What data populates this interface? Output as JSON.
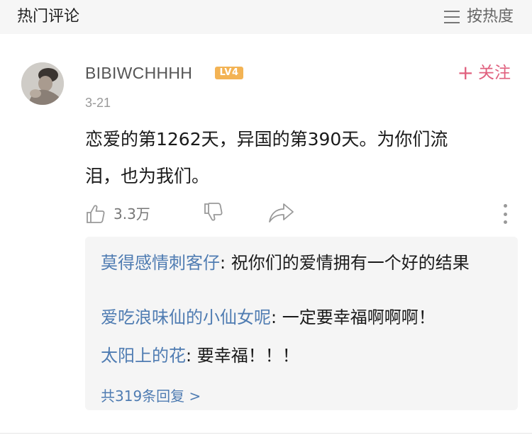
{
  "header": {
    "title": "热门评论",
    "sort_label": "按热度",
    "sort_icon": "menu-lines-icon"
  },
  "comment": {
    "avatar_icon": "user-avatar",
    "username": "BIBIWCHHHH",
    "level": "LV4",
    "follow_label": "关注",
    "date": "3-21",
    "text_line1": "恋爱的第1262天，异国的第390天。为你们流",
    "text_line2": "泪，也为我们。",
    "likes": "3.3万"
  },
  "replies": [
    {
      "name": "莫得感情刺客仔",
      "sep": ": ",
      "text": "祝你们的爱情拥有一个好的结果"
    },
    {
      "name": "爱吃浪味仙的小仙女呢",
      "sep": ": ",
      "text": "一定要幸福啊啊啊！"
    },
    {
      "name": "太阳上的花",
      "sep": ": ",
      "text": "要幸福！！！"
    }
  ],
  "total_replies": "共319条回复 >",
  "colors": {
    "link_blue": "#4f7cb2",
    "follow_pink": "#e0607e",
    "level_orange": "#f3b354"
  }
}
